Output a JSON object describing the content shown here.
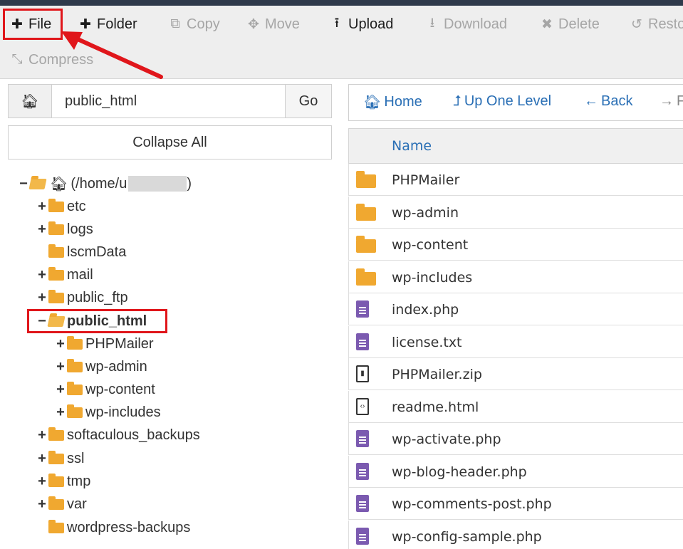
{
  "toolbar": {
    "items": [
      {
        "label": "File",
        "icon": "plus-icon",
        "enabled": true
      },
      {
        "label": "Folder",
        "icon": "plus-icon",
        "enabled": true
      },
      {
        "label": "Copy",
        "icon": "copy-icon",
        "enabled": false
      },
      {
        "label": "Move",
        "icon": "move-icon",
        "enabled": false
      },
      {
        "label": "Upload",
        "icon": "upload-icon",
        "enabled": true
      },
      {
        "label": "Download",
        "icon": "download-icon",
        "enabled": false
      },
      {
        "label": "Delete",
        "icon": "delete-icon",
        "enabled": false
      },
      {
        "label": "Resto",
        "icon": "restore-icon",
        "enabled": false
      },
      {
        "label": "Compress",
        "icon": "compress-icon",
        "enabled": false
      }
    ]
  },
  "path": {
    "value": "public_html",
    "go_label": "Go"
  },
  "collapse_label": "Collapse All",
  "tree": [
    {
      "toggle": "−",
      "label": "(/home/u",
      "redacted": true,
      "home": true,
      "open": true
    },
    {
      "toggle": "+",
      "label": "etc"
    },
    {
      "toggle": "+",
      "label": "logs"
    },
    {
      "toggle": "",
      "label": "lscmData"
    },
    {
      "toggle": "+",
      "label": "mail"
    },
    {
      "toggle": "+",
      "label": "public_ftp"
    },
    {
      "toggle": "−",
      "label": "public_html",
      "open": true,
      "bold": true
    },
    {
      "toggle": "+",
      "label": "PHPMailer"
    },
    {
      "toggle": "+",
      "label": "wp-admin"
    },
    {
      "toggle": "+",
      "label": "wp-content"
    },
    {
      "toggle": "+",
      "label": "wp-includes"
    },
    {
      "toggle": "+",
      "label": "softaculous_backups"
    },
    {
      "toggle": "+",
      "label": "ssl"
    },
    {
      "toggle": "+",
      "label": "tmp"
    },
    {
      "toggle": "+",
      "label": "var"
    },
    {
      "toggle": "",
      "label": "wordpress-backups"
    }
  ],
  "nav": {
    "home": "Home",
    "up": "Up One Level",
    "back": "Back",
    "forward": "F"
  },
  "files": {
    "header": "Name",
    "rows": [
      {
        "name": "PHPMailer",
        "icon": "folder-icon"
      },
      {
        "name": "wp-admin",
        "icon": "folder-icon"
      },
      {
        "name": "wp-content",
        "icon": "folder-icon"
      },
      {
        "name": "wp-includes",
        "icon": "folder-icon"
      },
      {
        "name": "index.php",
        "icon": "text-file-icon"
      },
      {
        "name": "license.txt",
        "icon": "text-file-icon"
      },
      {
        "name": "PHPMailer.zip",
        "icon": "zip-file-icon"
      },
      {
        "name": "readme.html",
        "icon": "html-file-icon"
      },
      {
        "name": "wp-activate.php",
        "icon": "text-file-icon"
      },
      {
        "name": "wp-blog-header.php",
        "icon": "text-file-icon"
      },
      {
        "name": "wp-comments-post.php",
        "icon": "text-file-icon"
      },
      {
        "name": "wp-config-sample.php",
        "icon": "text-file-icon"
      }
    ]
  },
  "colors": {
    "highlight": "#e0161b",
    "link": "#2a6fb5",
    "folder": "#f0a830",
    "doc": "#7b5ab0"
  }
}
